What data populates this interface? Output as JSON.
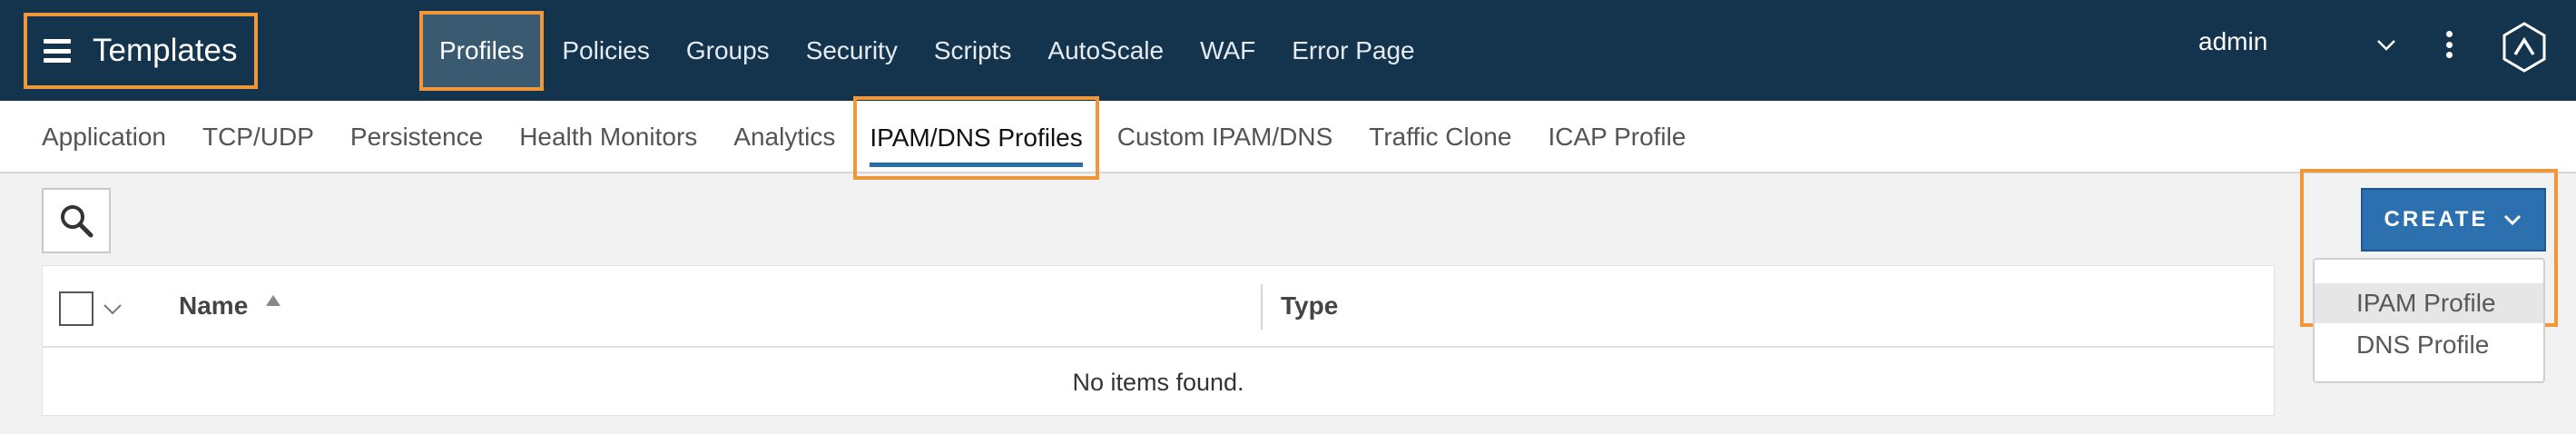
{
  "header": {
    "title": "Templates",
    "nav_items": [
      "Profiles",
      "Policies",
      "Groups",
      "Security",
      "Scripts",
      "AutoScale",
      "WAF",
      "Error Page"
    ],
    "active_nav": "Profiles",
    "user": "admin",
    "icons": [
      "menu-icon",
      "chevron-down-icon",
      "kebab-icon",
      "logo-icon"
    ]
  },
  "subnav": {
    "tabs": [
      "Application",
      "TCP/UDP",
      "Persistence",
      "Health Monitors",
      "Analytics",
      "IPAM/DNS Profiles",
      "Custom IPAM/DNS",
      "Traffic Clone",
      "ICAP Profile"
    ],
    "active_tab": "IPAM/DNS Profiles"
  },
  "toolbar": {
    "search_icon": "search-icon",
    "create_label": "CREATE",
    "create_menu": [
      "IPAM Profile",
      "DNS Profile"
    ],
    "hovered_item": "IPAM Profile"
  },
  "table": {
    "columns": [
      "Name",
      "Type"
    ],
    "sorted_column": "Name",
    "sort_direction": "ascending",
    "empty_message": "No items found."
  },
  "colors": {
    "topbar": "#14344d",
    "highlight": "#f0973a",
    "accent": "#2c70b0"
  }
}
